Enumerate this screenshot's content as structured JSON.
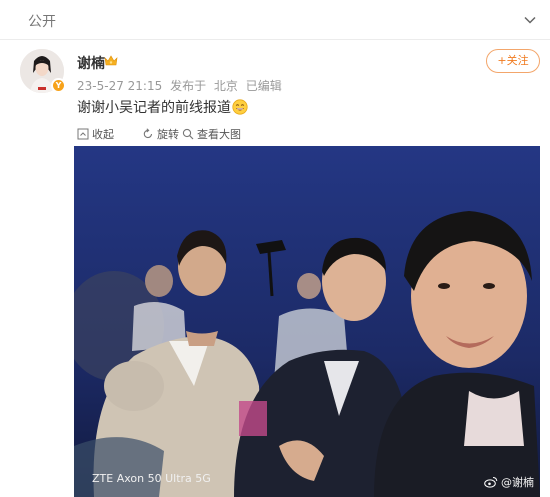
{
  "header": {
    "title": "公开",
    "chevron_icon": "chevron-down-icon"
  },
  "post": {
    "author": {
      "name": "谢楠",
      "verified_badge": "Y",
      "badge_color": "#f7a21a",
      "crown_icon": "crown-icon"
    },
    "meta": {
      "timestamp": "23-5-27 21:15",
      "location_prefix": "发布于",
      "location": "北京",
      "edited": "已编辑"
    },
    "follow_button": {
      "label": "+关注"
    },
    "text": "谢谢小吴记者的前线报道",
    "emoji_icon": "grinning-face-emoji",
    "actions": [
      {
        "label": "收起",
        "icon": "collapse-icon"
      },
      {
        "label": "旋转",
        "icon": "rotate-icon"
      },
      {
        "label": "查看大图",
        "icon": "zoom-icon"
      }
    ],
    "photo": {
      "camera_watermark": "ZTE Axon 50 Ultra 5G",
      "weibo_watermark": "@谢楠"
    }
  },
  "colors": {
    "accent": "#f07b20",
    "link_gray": "#999999",
    "photo_bg": "#1f2d6b"
  }
}
